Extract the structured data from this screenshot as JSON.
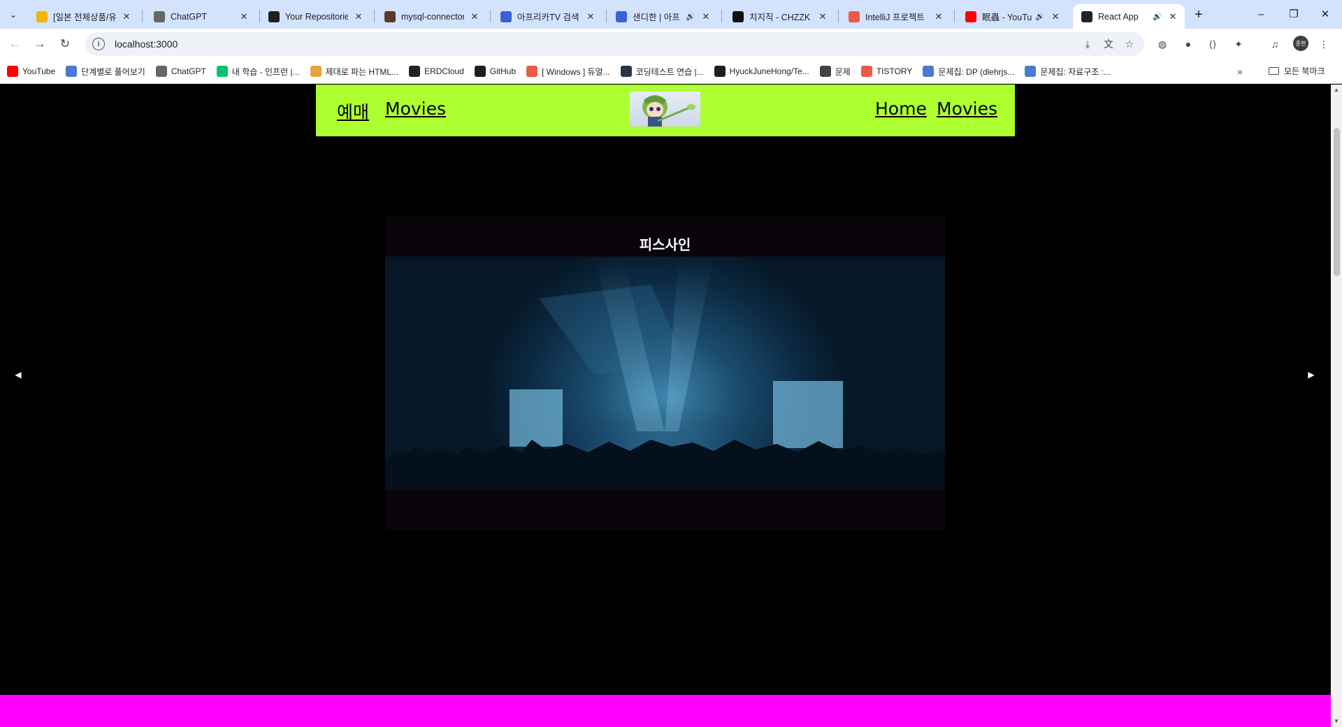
{
  "browser": {
    "tabs": [
      {
        "title": "[일본 전체상품/유",
        "favicon": "lightbulb-icon",
        "color": "#f4b400"
      },
      {
        "title": "ChatGPT",
        "favicon": "chatgpt-icon",
        "color": "#666666"
      },
      {
        "title": "Your Repositories",
        "favicon": "github-icon",
        "color": "#1f1f1f"
      },
      {
        "title": "mysql-connector",
        "favicon": "user-avatar-icon",
        "color": "#5a3a2a"
      },
      {
        "title": "아프리카TV 검색",
        "favicon": "afreecatv-icon",
        "color": "#3a62d6"
      },
      {
        "title": "샌디한 | 아프",
        "favicon": "afreecatv-icon",
        "color": "#3a62d6"
      },
      {
        "title": "치지직 - CHZZK",
        "favicon": "chzzk-icon",
        "color": "#111111"
      },
      {
        "title": "IntelliJ 프로젝트",
        "favicon": "tistory-icon",
        "color": "#eb5a46"
      },
      {
        "title": "眠蟲 - YouTub",
        "favicon": "youtube-icon",
        "color": "#ff0000"
      },
      {
        "title": "React App",
        "favicon": "react-icon",
        "color": "#20232a"
      }
    ],
    "new_tab": "+",
    "url": "localhost:3000",
    "profile_label": "종현",
    "bookmarks": [
      {
        "label": "YouTube",
        "icon": "youtube-icon",
        "color": "#ff0000"
      },
      {
        "label": "단계별로 풀어보기",
        "icon": "code-icon",
        "color": "#4a7bd0"
      },
      {
        "label": "ChatGPT",
        "icon": "chatgpt-icon",
        "color": "#666666"
      },
      {
        "label": "내 학습 - 인프런 |...",
        "icon": "inflearn-icon",
        "color": "#00c471"
      },
      {
        "label": "제대로 파는 HTML...",
        "icon": "braces-icon",
        "color": "#e8a33c"
      },
      {
        "label": "ERDCloud",
        "icon": "erd-icon",
        "color": "#222222"
      },
      {
        "label": "GitHub",
        "icon": "github-icon",
        "color": "#1f1f1f"
      },
      {
        "label": "[ Windows ] 듀얼...",
        "icon": "tistory-icon",
        "color": "#eb5a46"
      },
      {
        "label": "코딩테스트 연습 |...",
        "icon": "programmers-icon",
        "color": "#263747"
      },
      {
        "label": "HyuckJuneHong/Te...",
        "icon": "github-icon",
        "color": "#1f1f1f"
      },
      {
        "label": "문제",
        "icon": "folder-icon",
        "color": "#444444"
      },
      {
        "label": "TISTORY",
        "icon": "tistory-icon",
        "color": "#eb5a46"
      },
      {
        "label": "문제집: DP (dlehrjs...",
        "icon": "code-icon",
        "color": "#4a7bd0"
      },
      {
        "label": "문제집: 자료구조 :...",
        "icon": "code-icon",
        "color": "#4a7bd0"
      }
    ],
    "more_bookmarks": "»",
    "all_bookmarks": "모든 북마크"
  },
  "site": {
    "header_bg": "#adff2f",
    "nav_left": [
      "예매",
      "Movies"
    ],
    "nav_right": [
      "Home",
      "Movies"
    ],
    "slide": {
      "title": "피스사인",
      "image_desc_icon": "concert-stage-image"
    },
    "prev_label": "◀",
    "next_label": "▶",
    "footer_color": "#ff00ff"
  }
}
